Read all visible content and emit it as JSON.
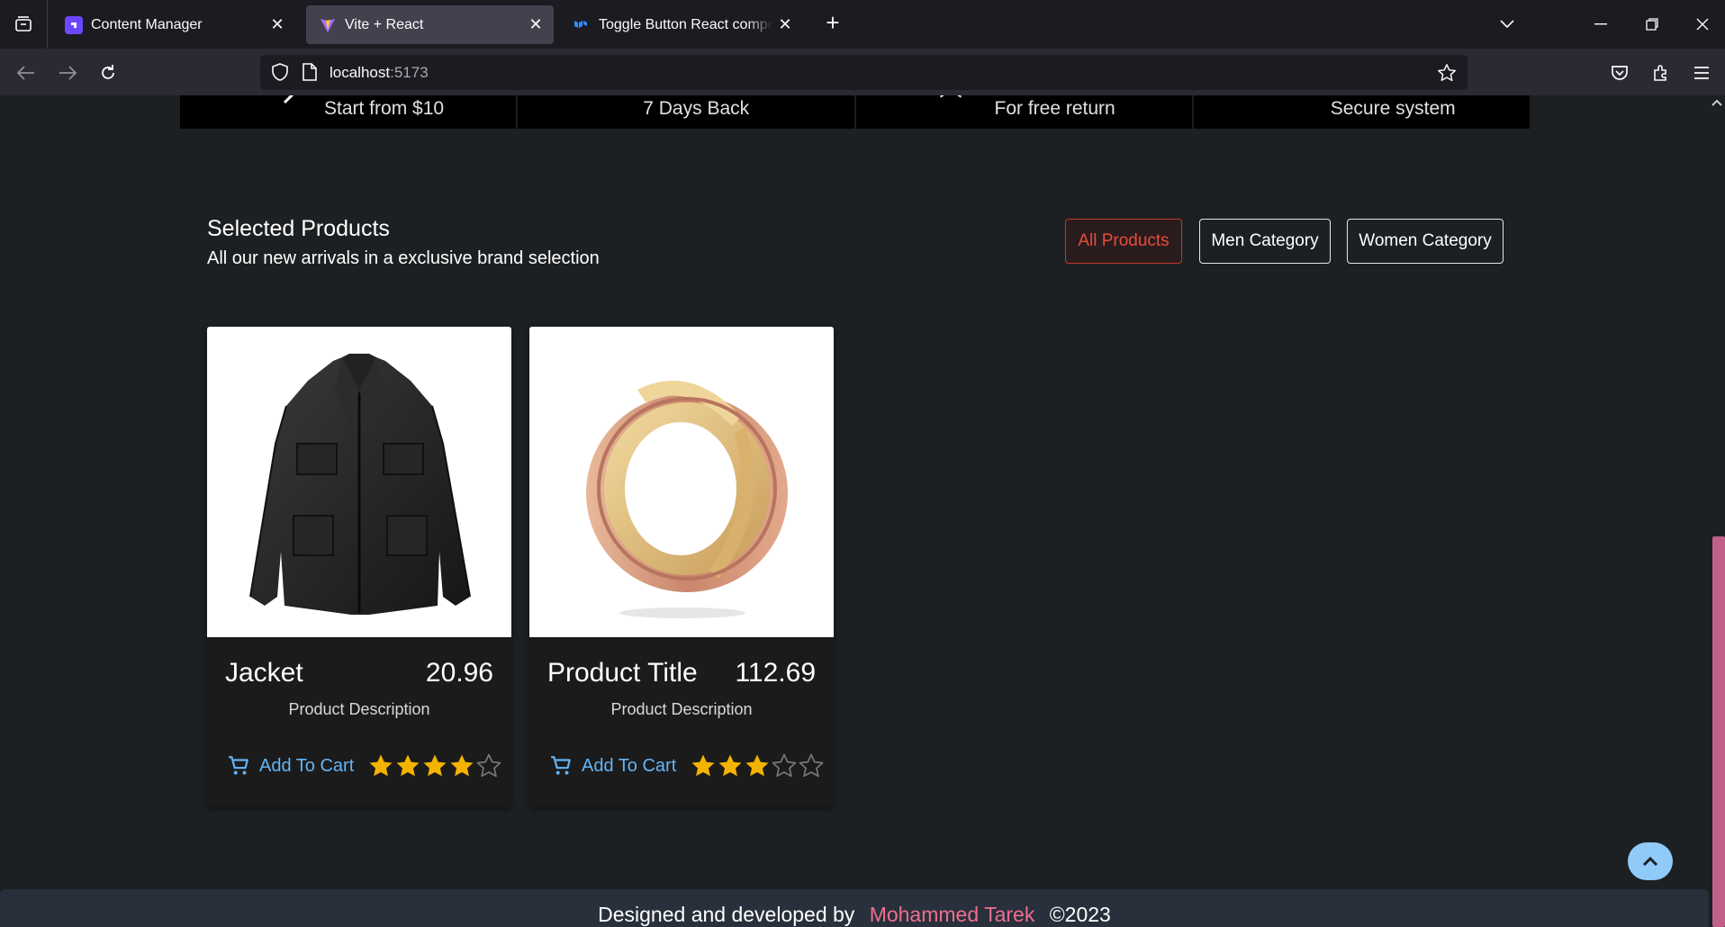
{
  "browser": {
    "tabs": [
      {
        "title": "Content Manager",
        "active": false
      },
      {
        "title": "Vite + React",
        "active": true
      },
      {
        "title": "Toggle Button React component",
        "active": false
      }
    ],
    "url": {
      "host": "localhost",
      "port": ":5173"
    }
  },
  "features": [
    {
      "text": "Start from $10",
      "icon": "arrow-icon"
    },
    {
      "text": "7 Days Back",
      "icon": "return-check-icon"
    },
    {
      "text": "For free return",
      "icon": "bookmark-icon"
    },
    {
      "text": "Secure system",
      "icon": "circle-icon"
    }
  ],
  "section": {
    "title": "Selected Products",
    "subtitle": "All our new arrivals in a exclusive brand selection"
  },
  "filters": [
    {
      "label": "All Products",
      "active": true
    },
    {
      "label": "Men Category",
      "active": false
    },
    {
      "label": "Women Category",
      "active": false
    }
  ],
  "products": [
    {
      "name": "Jacket",
      "price": "20.96",
      "description": "Product Description",
      "cart_label": "Add To Cart",
      "rating": 4,
      "max_rating": 5,
      "image": "black-jacket"
    },
    {
      "name": "Product Title",
      "price": "112.69",
      "description": "Product Description",
      "cart_label": "Add To Cart",
      "rating": 3,
      "max_rating": 5,
      "image": "gold-ring"
    }
  ],
  "footer": {
    "prefix": "Designed and developed by",
    "author": "Mohammed Tarek",
    "year": "©2023"
  },
  "colors": {
    "page_bg": "#1d2022",
    "accent_red": "#e74c3c",
    "link_blue": "#64b5f6",
    "star": "#f5b301",
    "author_pink": "#ef6e8e",
    "footer_bg": "#28303b"
  }
}
